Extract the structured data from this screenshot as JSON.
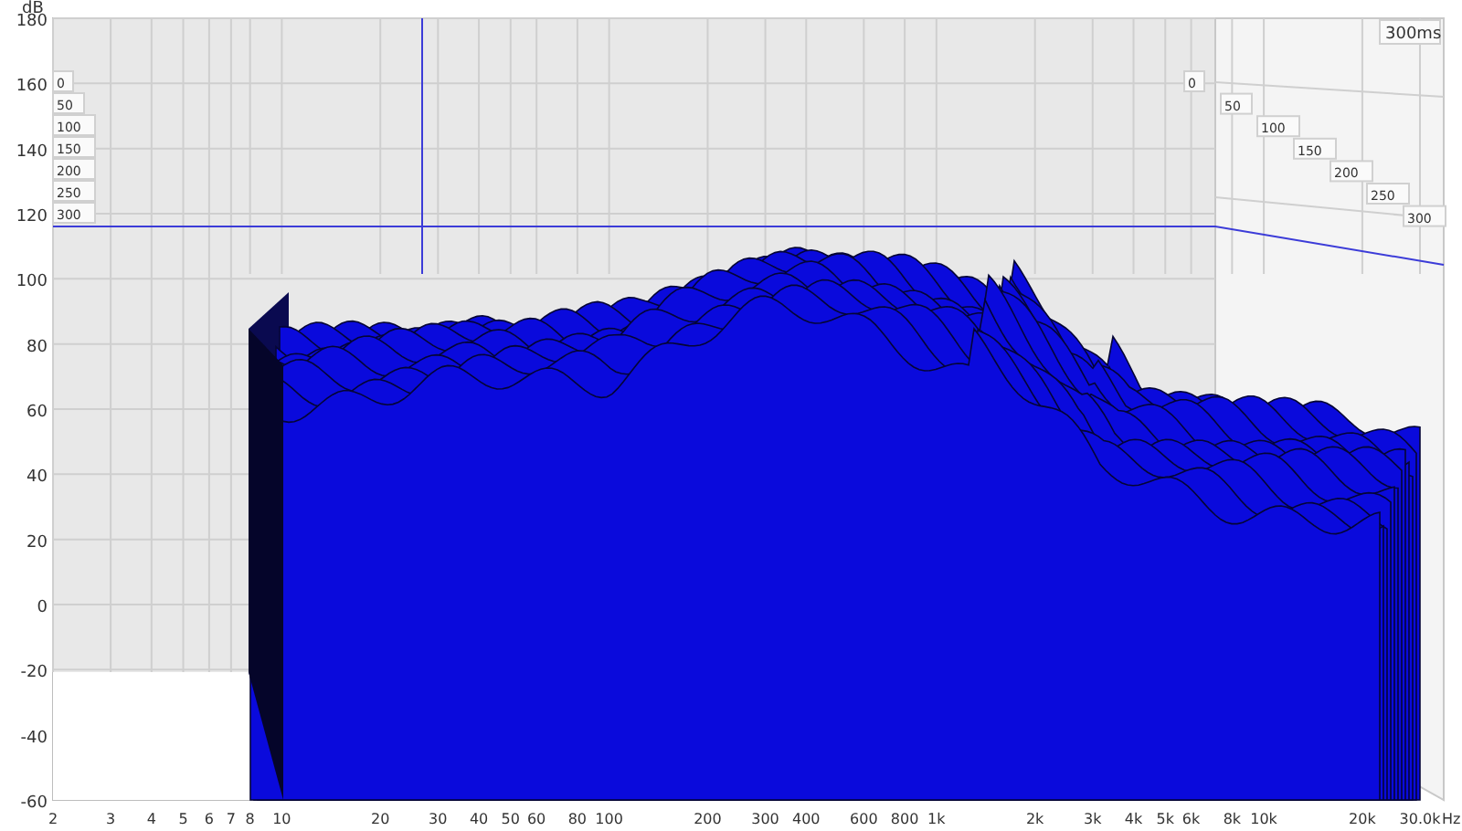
{
  "y_axis": {
    "unit": "dB",
    "ticks": [
      "180",
      "160",
      "140",
      "120",
      "100",
      "80",
      "60",
      "40",
      "20",
      "0",
      "-20",
      "-40",
      "-60"
    ]
  },
  "x_axis": {
    "unit": "Hz",
    "ticks": [
      "2",
      "3",
      "4",
      "5",
      "6",
      "7",
      "8",
      "10",
      "20",
      "30",
      "40",
      "50",
      "60",
      "80",
      "100",
      "200",
      "300",
      "400",
      "600",
      "800",
      "1k",
      "2k",
      "3k",
      "4k",
      "5k",
      "6k",
      "8k",
      "10k",
      "20k",
      "30.0k"
    ]
  },
  "time_axis": {
    "label": "300ms",
    "left_ticks": [
      "0",
      "50",
      "100",
      "150",
      "200",
      "250",
      "300"
    ],
    "right_ticks": [
      "0",
      "50",
      "100",
      "150",
      "200",
      "250",
      "300"
    ]
  }
}
